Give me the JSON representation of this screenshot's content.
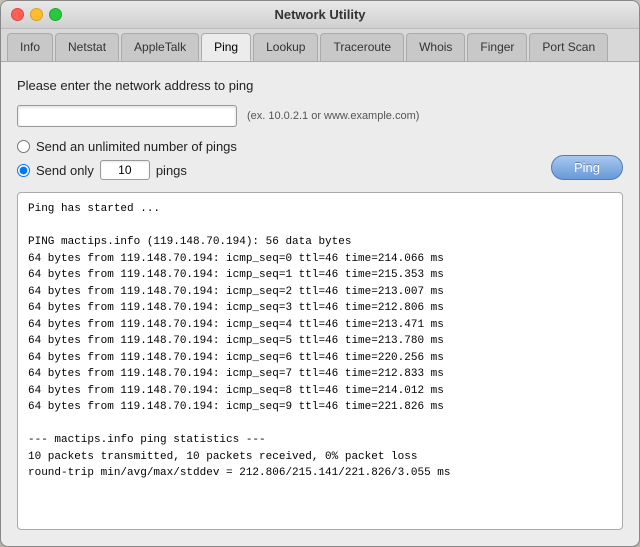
{
  "window": {
    "title": "Network Utility"
  },
  "tabs": [
    {
      "id": "info",
      "label": "Info",
      "active": false
    },
    {
      "id": "netstat",
      "label": "Netstat",
      "active": false
    },
    {
      "id": "appletalk",
      "label": "AppleTalk",
      "active": false
    },
    {
      "id": "ping",
      "label": "Ping",
      "active": true
    },
    {
      "id": "lookup",
      "label": "Lookup",
      "active": false
    },
    {
      "id": "traceroute",
      "label": "Traceroute",
      "active": false
    },
    {
      "id": "whois",
      "label": "Whois",
      "active": false
    },
    {
      "id": "finger",
      "label": "Finger",
      "active": false
    },
    {
      "id": "port-scan",
      "label": "Port Scan",
      "active": false
    }
  ],
  "ping_section": {
    "prompt": "Please enter the network address to ping",
    "address_value": "",
    "address_placeholder": "",
    "address_hint": "(ex. 10.0.2.1 or www.example.com)",
    "radio_unlimited": "Send an unlimited number of pings",
    "radio_only": "Send only",
    "ping_count": "10",
    "pings_label": "pings",
    "ping_button": "Ping"
  },
  "output": {
    "text": "Ping has started ...\n\nPING mactips.info (119.148.70.194): 56 data bytes\n64 bytes from 119.148.70.194: icmp_seq=0 ttl=46 time=214.066 ms\n64 bytes from 119.148.70.194: icmp_seq=1 ttl=46 time=215.353 ms\n64 bytes from 119.148.70.194: icmp_seq=2 ttl=46 time=213.007 ms\n64 bytes from 119.148.70.194: icmp_seq=3 ttl=46 time=212.806 ms\n64 bytes from 119.148.70.194: icmp_seq=4 ttl=46 time=213.471 ms\n64 bytes from 119.148.70.194: icmp_seq=5 ttl=46 time=213.780 ms\n64 bytes from 119.148.70.194: icmp_seq=6 ttl=46 time=220.256 ms\n64 bytes from 119.148.70.194: icmp_seq=7 ttl=46 time=212.833 ms\n64 bytes from 119.148.70.194: icmp_seq=8 ttl=46 time=214.012 ms\n64 bytes from 119.148.70.194: icmp_seq=9 ttl=46 time=221.826 ms\n\n--- mactips.info ping statistics ---\n10 packets transmitted, 10 packets received, 0% packet loss\nround-trip min/avg/max/stddev = 212.806/215.141/221.826/3.055 ms"
  }
}
